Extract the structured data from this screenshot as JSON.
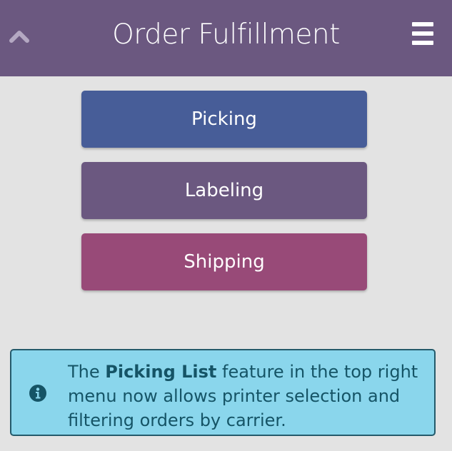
{
  "header": {
    "title": "Order Fulfillment",
    "back_icon": "chevron-up-icon",
    "menu_icon": "hamburger-menu-icon"
  },
  "actions": [
    {
      "label": "Picking",
      "color": "#475d98"
    },
    {
      "label": "Labeling",
      "color": "#6b5880"
    },
    {
      "label": "Shipping",
      "color": "#984a78"
    }
  ],
  "notice": {
    "icon": "info-circle-icon",
    "text_before": "The ",
    "highlight": "Picking List",
    "text_after": " feature in the top right menu now allows printer selection and filtering orders by carrier."
  },
  "colors": {
    "header_bg": "#6b5880",
    "page_bg": "#e3e3e3",
    "notice_bg": "#8ad6ec",
    "notice_border": "#245a6b",
    "notice_text": "#155466"
  }
}
